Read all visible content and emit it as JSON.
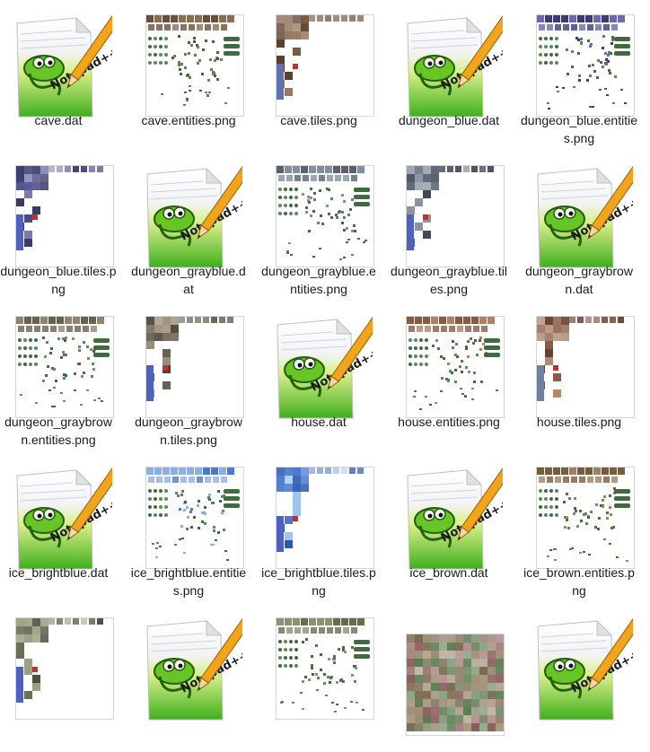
{
  "view": "file-explorer-large-icons",
  "files": [
    {
      "name": "cave.dat",
      "type": "notepad",
      "col": 0,
      "row": 0
    },
    {
      "name": "cave.entities.png",
      "type": "entities",
      "col": 1,
      "row": 0,
      "palette": [
        "#6b4f3a",
        "#8a7050",
        "#3c6e3c",
        "#5a8a5a"
      ]
    },
    {
      "name": "cave.tiles.png",
      "type": "tiles",
      "col": 2,
      "row": 0,
      "palette": [
        "#7a5a40",
        "#5a4030",
        "#9a7a60",
        "#6070b0"
      ]
    },
    {
      "name": "dungeon_blue.dat",
      "type": "notepad",
      "col": 3,
      "row": 0
    },
    {
      "name": "dungeon_blue.entities.png",
      "type": "entities",
      "col": 4,
      "row": 0,
      "palette": [
        "#3a3a7a",
        "#6a6ab0",
        "#3c6e3c",
        "#5a8a5a"
      ]
    },
    {
      "name": "dungeon_blue.tiles.png",
      "type": "tiles",
      "col": 0,
      "row": 1,
      "palette": [
        "#4a4a8a",
        "#3a3a6a",
        "#7a7ab0",
        "#5060c0"
      ]
    },
    {
      "name": "dungeon_grayblue.dat",
      "type": "notepad",
      "col": 1,
      "row": 1
    },
    {
      "name": "dungeon_grayblue.entities.png",
      "type": "entities",
      "col": 2,
      "row": 1,
      "palette": [
        "#5a6070",
        "#8090a0",
        "#3c6e3c",
        "#5a8a5a"
      ]
    },
    {
      "name": "dungeon_grayblue.tiles.png",
      "type": "tiles",
      "col": 3,
      "row": 1,
      "palette": [
        "#5a6070",
        "#404858",
        "#8a94a4",
        "#5060c0"
      ]
    },
    {
      "name": "dungeon_graybrown.dat",
      "type": "notepad",
      "col": 4,
      "row": 1
    },
    {
      "name": "dungeon_graybrown.entities.png",
      "type": "entities",
      "col": 0,
      "row": 2,
      "palette": [
        "#6a6050",
        "#908470",
        "#3c6e3c",
        "#5a8a5a"
      ]
    },
    {
      "name": "dungeon_graybrown.tiles.png",
      "type": "tiles",
      "col": 1,
      "row": 2,
      "palette": [
        "#6a6050",
        "#4a4438",
        "#9a8e78",
        "#5060c0"
      ]
    },
    {
      "name": "house.dat",
      "type": "notepad",
      "col": 2,
      "row": 2
    },
    {
      "name": "house.entities.png",
      "type": "entities",
      "col": 3,
      "row": 2,
      "palette": [
        "#8a5a40",
        "#b08060",
        "#3c6e3c",
        "#5a8a5a"
      ]
    },
    {
      "name": "house.tiles.png",
      "type": "tiles",
      "col": 4,
      "row": 2,
      "palette": [
        "#8a5a48",
        "#6a4030",
        "#b08a70",
        "#7080a0"
      ]
    },
    {
      "name": "ice_brightblue.dat",
      "type": "notepad",
      "col": 0,
      "row": 3
    },
    {
      "name": "ice_brightblue.entities.png",
      "type": "entities",
      "col": 1,
      "row": 3,
      "palette": [
        "#4a7ad0",
        "#8ab0e8",
        "#3c6e3c",
        "#5a8a5a"
      ]
    },
    {
      "name": "ice_brightblue.tiles.png",
      "type": "tiles",
      "col": 2,
      "row": 3,
      "palette": [
        "#4a7ad0",
        "#2a5ab0",
        "#a0c4f0",
        "#5060c0"
      ]
    },
    {
      "name": "ice_brown.dat",
      "type": "notepad",
      "col": 3,
      "row": 3
    },
    {
      "name": "ice_brown.entities.png",
      "type": "entities",
      "col": 4,
      "row": 3,
      "palette": [
        "#7a5a3a",
        "#a08060",
        "#3c6e3c",
        "#5a8a5a"
      ]
    },
    {
      "name": "",
      "type": "tiles",
      "col": 0,
      "row": 4,
      "palette": [
        "#6a7058",
        "#4a5040",
        "#9aa080",
        "#5060c0"
      ]
    },
    {
      "name": "",
      "type": "notepad",
      "col": 1,
      "row": 4
    },
    {
      "name": "",
      "type": "entities",
      "col": 2,
      "row": 4,
      "palette": [
        "#6a6a50",
        "#909070",
        "#3c6e3c",
        "#5a8a5a"
      ]
    },
    {
      "name": "",
      "type": "dense",
      "col": 3,
      "row": 4,
      "palette": [
        "#7a6a50",
        "#5a7a50",
        "#a08a70",
        "#8a5a5a"
      ]
    },
    {
      "name": "",
      "type": "notepad",
      "col": 4,
      "row": 4
    }
  ]
}
